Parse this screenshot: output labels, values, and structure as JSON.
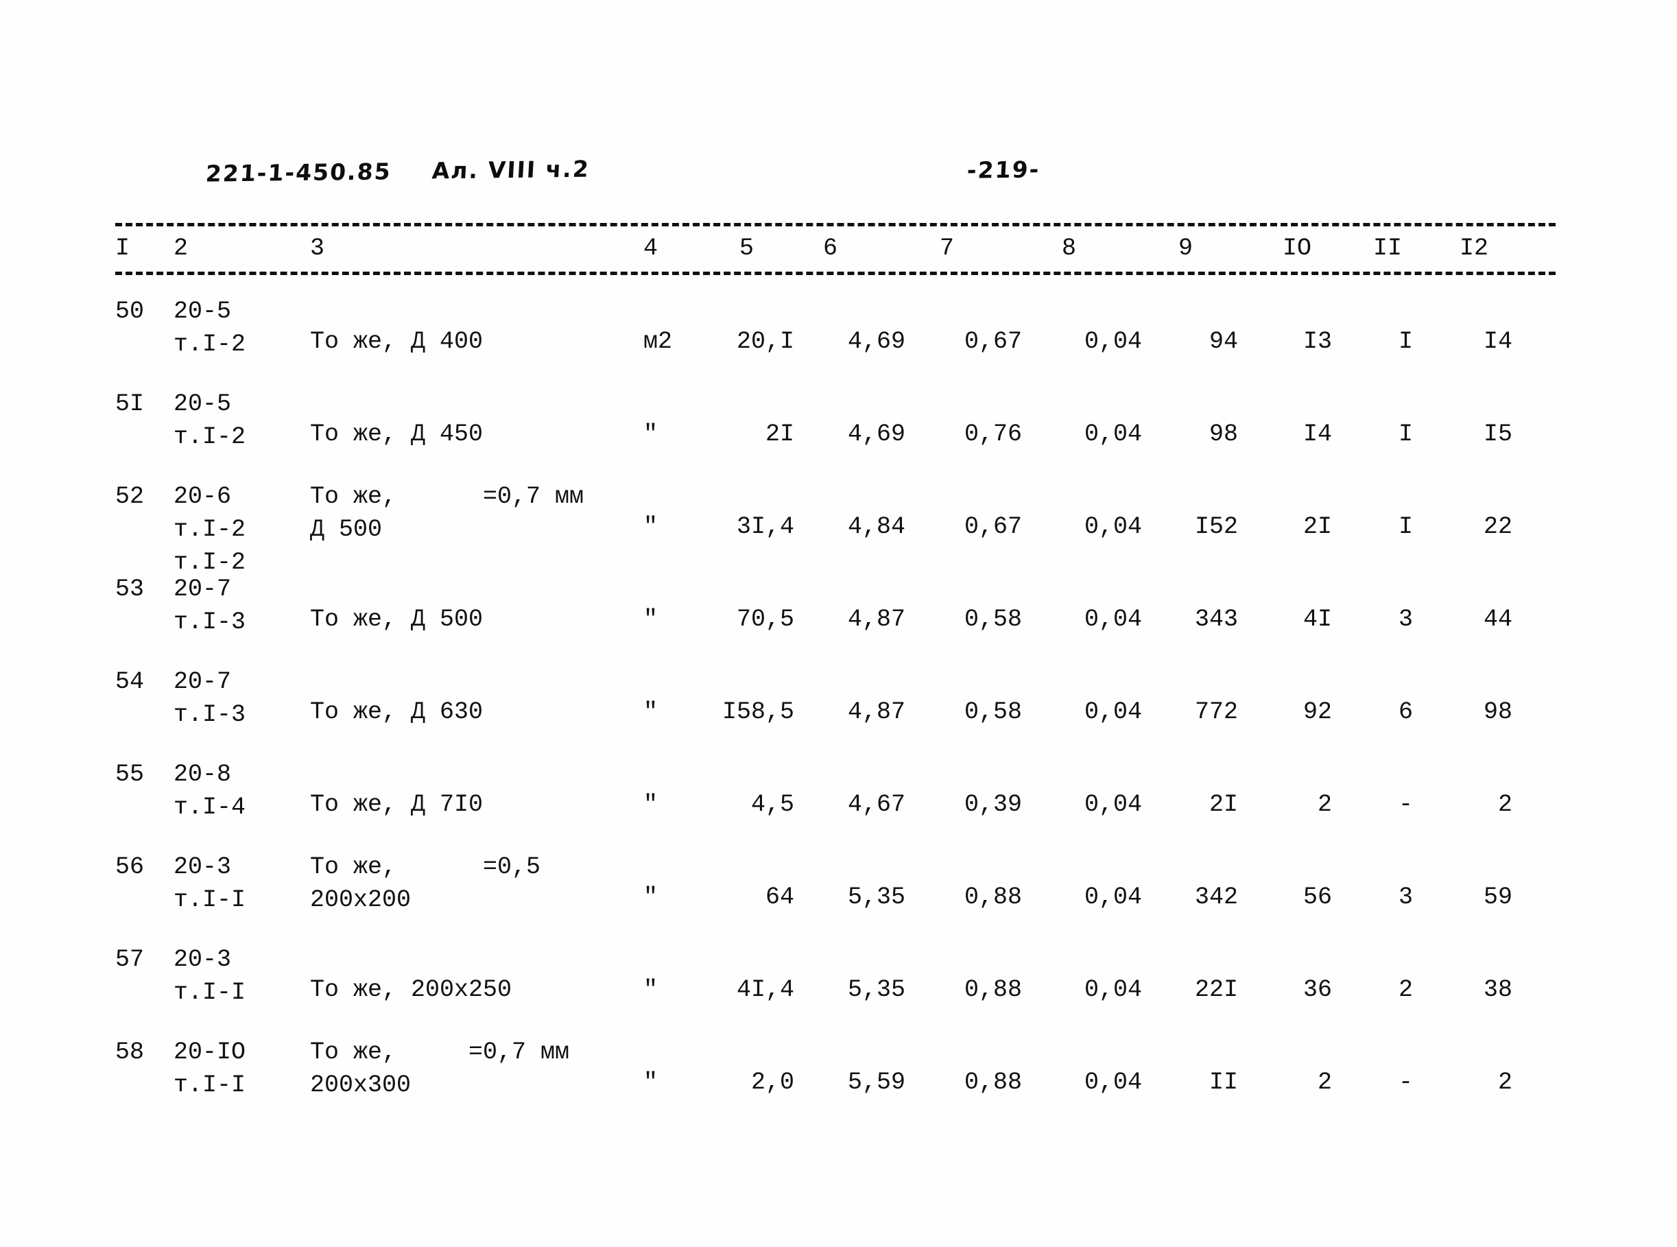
{
  "header": {
    "doc_code": "221-1-450.85",
    "album": "Ал. VIII ч.2",
    "page_number": "-219-"
  },
  "table": {
    "column_headers": [
      "I",
      "2",
      "3",
      "4",
      "5",
      "6",
      "7",
      "8",
      "9",
      "IO",
      "II",
      "I2"
    ],
    "rows": [
      {
        "num": "50",
        "code_lines": [
          "20-5",
          "т.I-2"
        ],
        "desc_lines": [
          "То же, Д 400"
        ],
        "unit": "м2",
        "values": [
          "20,I",
          "4,69",
          "0,67",
          "0,04",
          "94",
          "I3",
          "I",
          "I4"
        ]
      },
      {
        "num": "5I",
        "code_lines": [
          "20-5",
          "т.I-2"
        ],
        "desc_lines": [
          "То же, Д 450"
        ],
        "unit": "\"",
        "values": [
          "2I",
          "4,69",
          "0,76",
          "0,04",
          "98",
          "I4",
          "I",
          "I5"
        ]
      },
      {
        "num": "52",
        "code_lines": [
          "20-6",
          "т.I-2",
          "т.I-2"
        ],
        "desc_lines": [
          "То же,      =0,7 мм",
          "Д 500"
        ],
        "unit": "\"",
        "values": [
          "3I,4",
          "4,84",
          "0,67",
          "0,04",
          "I52",
          "2I",
          "I",
          "22"
        ]
      },
      {
        "num": "53",
        "code_lines": [
          "20-7",
          "т.I-3"
        ],
        "desc_lines": [
          "То же, Д 500"
        ],
        "unit": "\"",
        "values": [
          "70,5",
          "4,87",
          "0,58",
          "0,04",
          "343",
          "4I",
          "3",
          "44"
        ]
      },
      {
        "num": "54",
        "code_lines": [
          "20-7",
          "т.I-3"
        ],
        "desc_lines": [
          "То же, Д 630"
        ],
        "unit": "\"",
        "values": [
          "I58,5",
          "4,87",
          "0,58",
          "0,04",
          "772",
          "92",
          "6",
          "98"
        ]
      },
      {
        "num": "55",
        "code_lines": [
          "20-8",
          "т.I-4"
        ],
        "desc_lines": [
          "То же, Д 7I0"
        ],
        "unit": "\"",
        "values": [
          "4,5",
          "4,67",
          "0,39",
          "0,04",
          "2I",
          "2",
          "-",
          "2"
        ]
      },
      {
        "num": "56",
        "code_lines": [
          "20-3",
          "т.I-I"
        ],
        "desc_lines": [
          "То же,      =0,5",
          "200х200"
        ],
        "unit": "\"",
        "values": [
          "64",
          "5,35",
          "0,88",
          "0,04",
          "342",
          "56",
          "3",
          "59"
        ]
      },
      {
        "num": "57",
        "code_lines": [
          "20-3",
          "т.I-I"
        ],
        "desc_lines": [
          "То же, 200х250"
        ],
        "unit": "\"",
        "values": [
          "4I,4",
          "5,35",
          "0,88",
          "0,04",
          "22I",
          "36",
          "2",
          "38"
        ]
      },
      {
        "num": "58",
        "code_lines": [
          "20-IO",
          "т.I-I"
        ],
        "desc_lines": [
          "То же,     =0,7 мм",
          "200х300"
        ],
        "unit": "\"",
        "values": [
          "2,0",
          "5,59",
          "0,88",
          "0,04",
          "II",
          "2",
          "-",
          "2"
        ]
      }
    ]
  }
}
